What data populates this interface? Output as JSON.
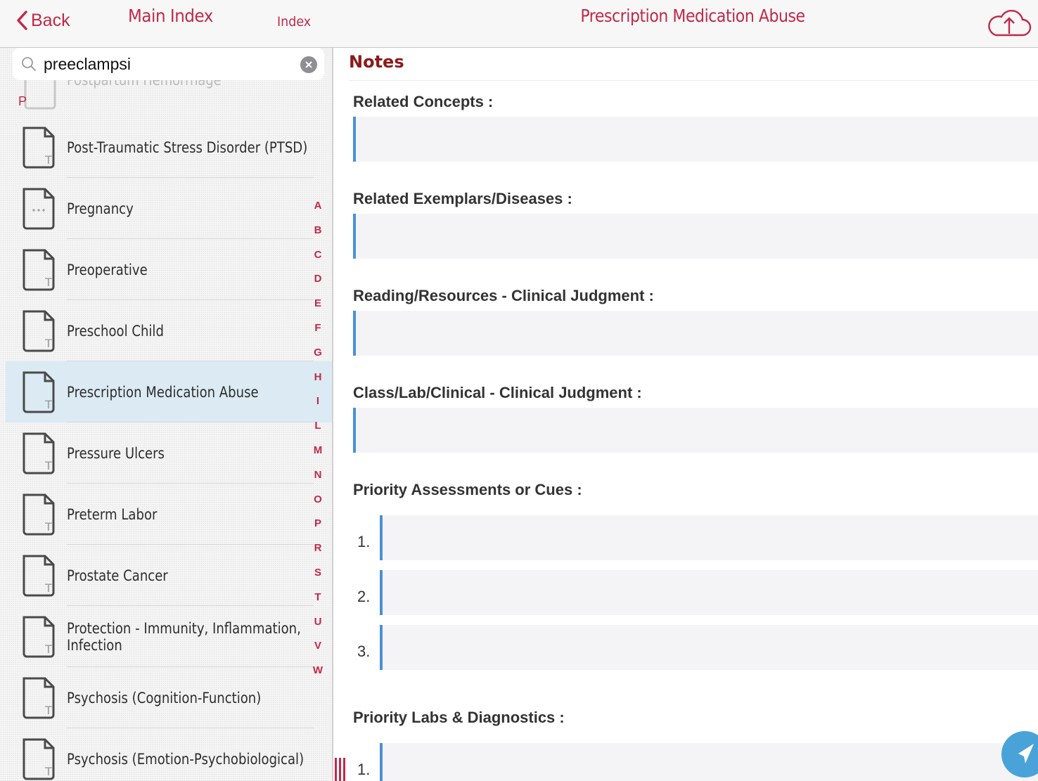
{
  "nav": {
    "back_label": "Back",
    "main_index_label": "Main Index",
    "index_label": "Index",
    "title": "Prescription Medication Abuse"
  },
  "search": {
    "value": "preeclampsi"
  },
  "index": {
    "clipped_item": "Postpartum Hemorrhage",
    "section_letter": "P",
    "items": [
      {
        "label": "Post-Traumatic Stress Disorder (PTSD)",
        "icon": "doc-t-icon"
      },
      {
        "label": "Pregnancy",
        "icon": "doc-dots-icon"
      },
      {
        "label": "Preoperative",
        "icon": "doc-t-icon"
      },
      {
        "label": "Preschool Child",
        "icon": "doc-t-icon"
      },
      {
        "label": "Prescription Medication Abuse",
        "icon": "doc-t-icon",
        "selected": true
      },
      {
        "label": "Pressure Ulcers",
        "icon": "doc-t-icon"
      },
      {
        "label": "Preterm Labor",
        "icon": "doc-t-icon"
      },
      {
        "label": "Prostate Cancer",
        "icon": "doc-t-icon"
      },
      {
        "label": "Protection - Immunity, Inflammation, Infection",
        "icon": "doc-t-icon"
      },
      {
        "label": "Psychosis (Cognition-Function)",
        "icon": "doc-t-icon"
      },
      {
        "label": "Psychosis (Emotion-Psychobiological)",
        "icon": "doc-t-icon"
      }
    ],
    "alphabet": [
      "A",
      "B",
      "C",
      "D",
      "E",
      "F",
      "G",
      "H",
      "I",
      "L",
      "M",
      "N",
      "O",
      "P",
      "R",
      "S",
      "T",
      "U",
      "V",
      "W"
    ]
  },
  "notes": {
    "title": "Notes",
    "sections": [
      {
        "label": "Related Concepts :",
        "value": ""
      },
      {
        "label": "Related Exemplars/Diseases :",
        "value": ""
      },
      {
        "label": "Reading/Resources - Clinical Judgment :",
        "value": ""
      },
      {
        "label": "Class/Lab/Clinical - Clinical Judgment :",
        "value": ""
      }
    ],
    "priority_assessments": {
      "label": "Priority Assessments or Cues :",
      "numbers": [
        "1.",
        "2.",
        "3."
      ]
    },
    "priority_labs": {
      "label": "Priority Labs & Diagnostics :",
      "numbers": [
        "1."
      ]
    }
  },
  "colors": {
    "accent": "#c0294a",
    "notes_title": "#8b1a1a",
    "field_border": "#4a90d9",
    "selected_row": "#dbeaf3",
    "fab": "#4aa3d8"
  }
}
